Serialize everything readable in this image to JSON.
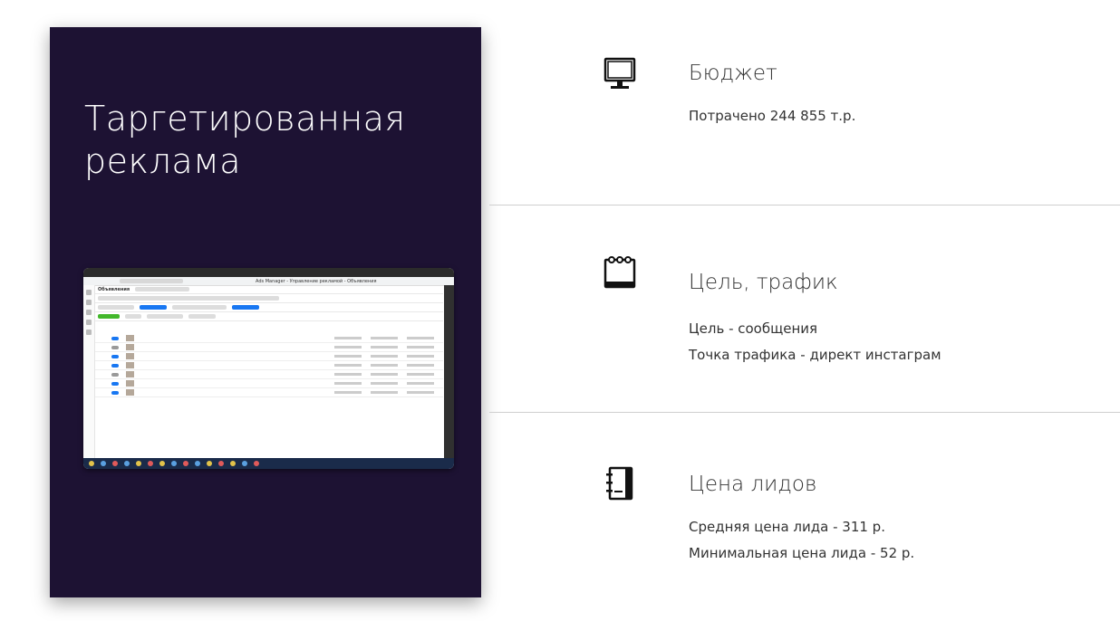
{
  "card": {
    "title": "Таргетированная реклама",
    "background": "#1d1233",
    "screenshot": {
      "window_title": "Ads Manager - Управление рекламой - Объявления",
      "panel_label": "Объявления"
    }
  },
  "sections": [
    {
      "icon": "monitor-icon",
      "title": "Бюджет",
      "lines": [
        "Потрачено 244 855 т.р."
      ]
    },
    {
      "icon": "notepad-icon",
      "title": "Цель, трафик",
      "lines": [
        "Цель - сообщения",
        "Точка трафика - директ инстаграм"
      ]
    },
    {
      "icon": "contact-book-icon",
      "title": "Цена лидов",
      "lines": [
        "Средняя цена лида - 311 р.",
        "Минимальная цена лида - 52 р."
      ]
    }
  ]
}
